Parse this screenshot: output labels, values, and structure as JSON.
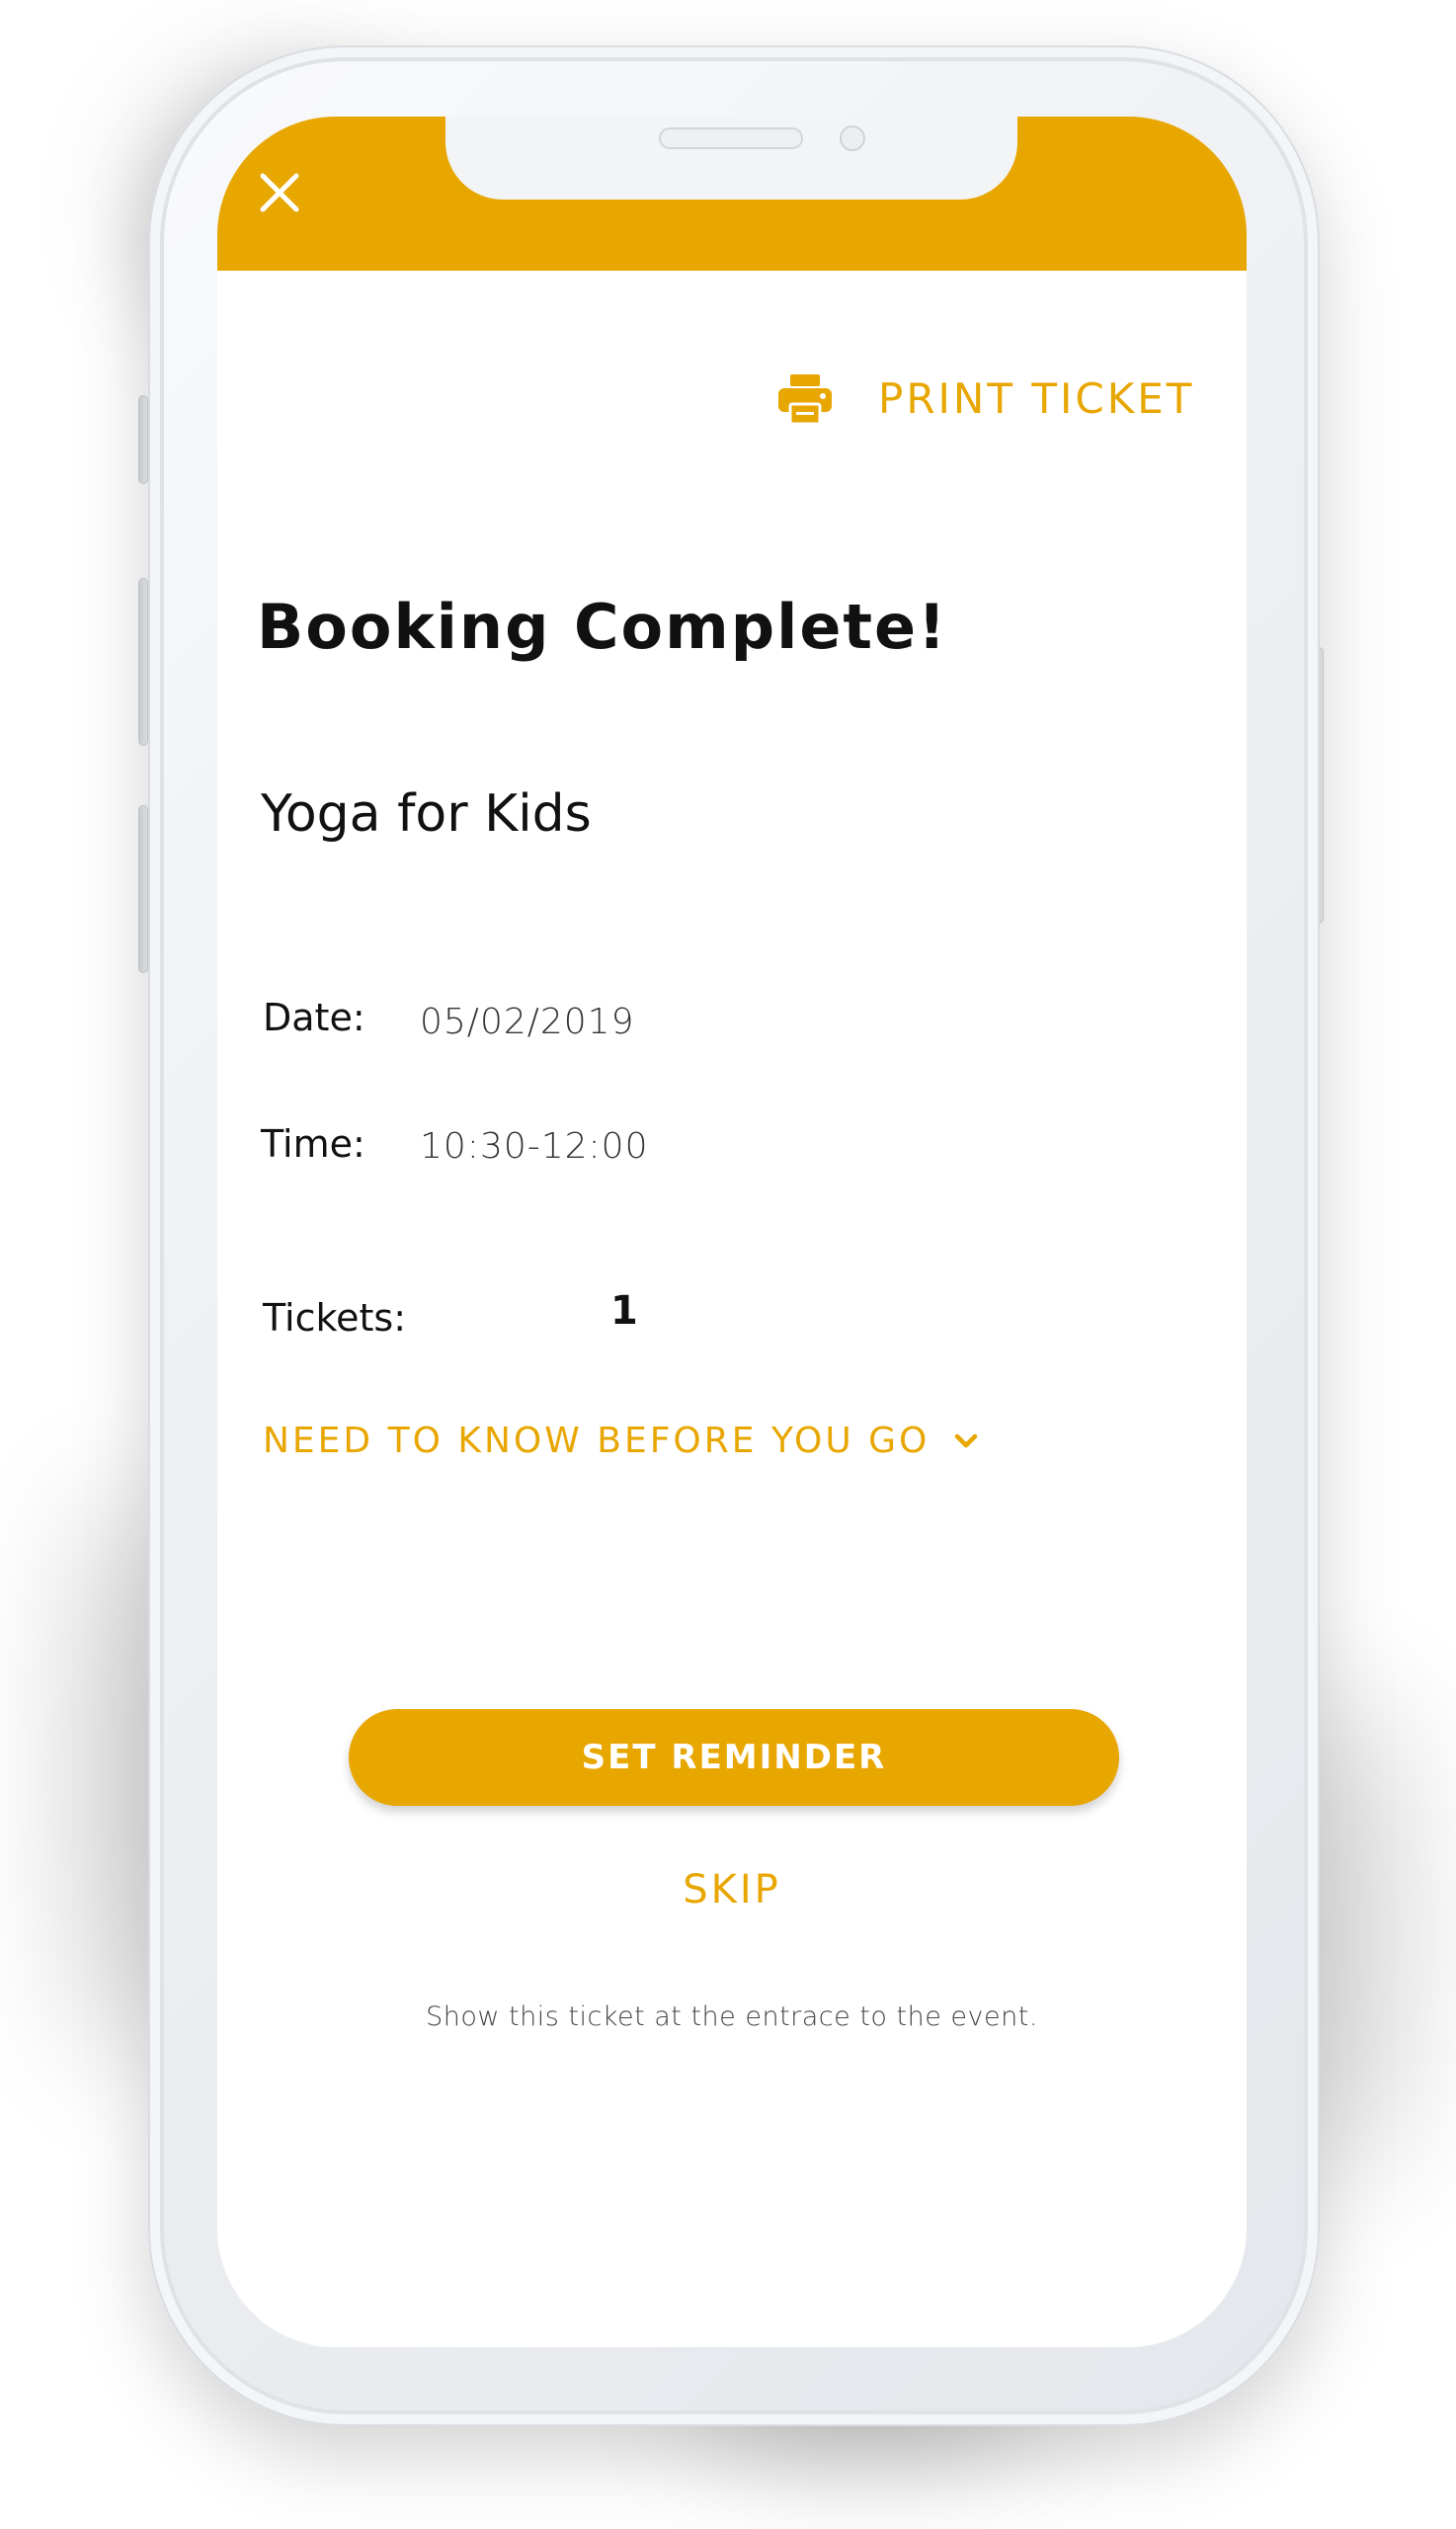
{
  "app": {
    "accent_color": "#e8a600"
  },
  "header": {
    "close_icon": "close-icon"
  },
  "actions": {
    "print_label": "PRINT TICKET",
    "print_icon": "printer-icon"
  },
  "booking": {
    "title": "Booking Complete!",
    "event_name": "Yoga for Kids",
    "date_label": "Date:",
    "date_value": "05/02/2019",
    "time_label": "Time:",
    "time_value": "10:30-12:00",
    "tickets_label": "Tickets:",
    "tickets_value": "1"
  },
  "info": {
    "need_to_know_label": "NEED TO KNOW BEFORE YOU GO",
    "expand_icon": "chevron-down-icon"
  },
  "buttons": {
    "set_reminder": "SET REMINDER",
    "skip": "SKIP"
  },
  "footer": {
    "note": "Show this ticket at the entrace to the event."
  }
}
